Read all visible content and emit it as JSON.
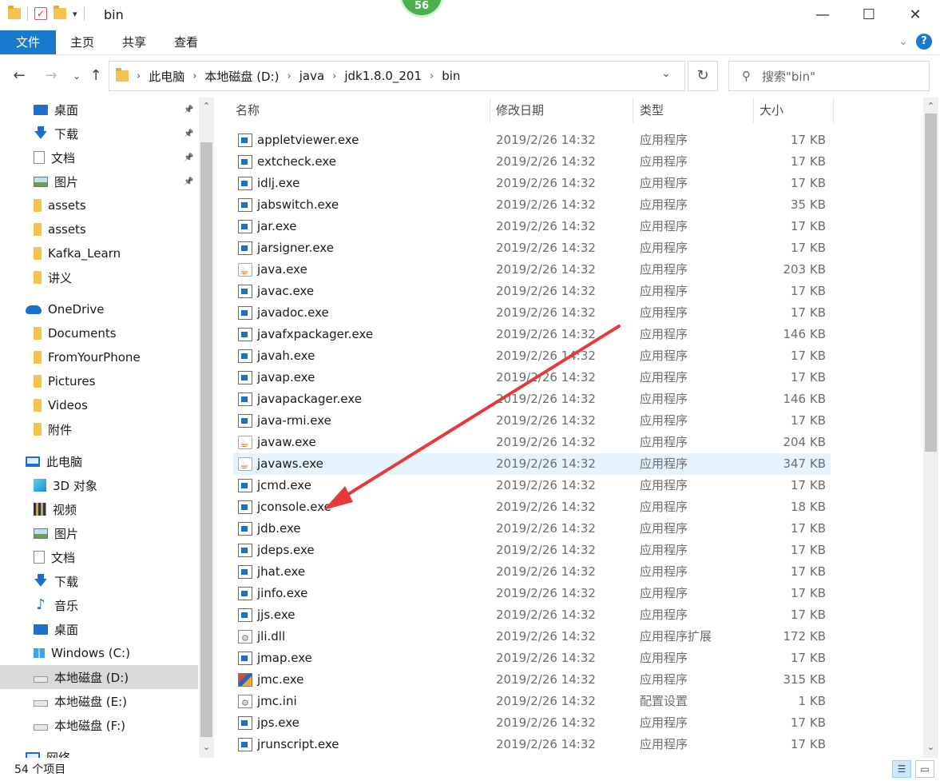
{
  "window": {
    "title": "bin",
    "badge": "56",
    "controls": {
      "minimize": "—",
      "maximize": "☐",
      "close": "✕"
    }
  },
  "ribbon": {
    "tabs": [
      "文件",
      "主页",
      "共享",
      "查看"
    ],
    "expand_icon": "chevron-down-icon",
    "help": "?"
  },
  "address": {
    "crumbs": [
      "此电脑",
      "本地磁盘 (D:)",
      "java",
      "jdk1.8.0_201",
      "bin"
    ],
    "search_placeholder": "搜索\"bin\""
  },
  "sidebar": {
    "items": [
      {
        "label": "桌面",
        "icon": "desktop-icon",
        "pinned": true
      },
      {
        "label": "下载",
        "icon": "download-icon",
        "pinned": true
      },
      {
        "label": "文档",
        "icon": "document-icon",
        "pinned": true
      },
      {
        "label": "图片",
        "icon": "picture-icon",
        "pinned": true
      },
      {
        "label": "assets",
        "icon": "folder-icon"
      },
      {
        "label": "assets",
        "icon": "folder-icon"
      },
      {
        "label": "Kafka_Learn",
        "icon": "folder-icon"
      },
      {
        "label": "讲义",
        "icon": "folder-icon"
      },
      {
        "label": "OneDrive",
        "icon": "onedrive-icon"
      },
      {
        "label": "Documents",
        "icon": "folder-icon"
      },
      {
        "label": "FromYourPhone",
        "icon": "folder-icon"
      },
      {
        "label": "Pictures",
        "icon": "folder-icon"
      },
      {
        "label": "Videos",
        "icon": "folder-icon"
      },
      {
        "label": "附件",
        "icon": "folder-icon"
      },
      {
        "label": "此电脑",
        "icon": "this-pc-icon"
      },
      {
        "label": "3D 对象",
        "icon": "3d-objects-icon"
      },
      {
        "label": "视频",
        "icon": "video-icon"
      },
      {
        "label": "图片",
        "icon": "picture-icon"
      },
      {
        "label": "文档",
        "icon": "document-icon"
      },
      {
        "label": "下载",
        "icon": "download-icon"
      },
      {
        "label": "音乐",
        "icon": "music-icon"
      },
      {
        "label": "桌面",
        "icon": "desktop-icon"
      },
      {
        "label": "Windows (C:)",
        "icon": "windows-drive-icon"
      },
      {
        "label": "本地磁盘 (D:)",
        "icon": "drive-icon",
        "selected": true
      },
      {
        "label": "本地磁盘 (E:)",
        "icon": "drive-icon"
      },
      {
        "label": "本地磁盘 (F:)",
        "icon": "drive-icon"
      },
      {
        "label": "网络",
        "icon": "network-icon"
      }
    ]
  },
  "columns": [
    "名称",
    "修改日期",
    "类型",
    "大小"
  ],
  "files": [
    {
      "name": "appletviewer.exe",
      "date": "2019/2/26 14:32",
      "type": "应用程序",
      "size": "17 KB",
      "icon": "exe-icon"
    },
    {
      "name": "extcheck.exe",
      "date": "2019/2/26 14:32",
      "type": "应用程序",
      "size": "17 KB",
      "icon": "exe-icon"
    },
    {
      "name": "idlj.exe",
      "date": "2019/2/26 14:32",
      "type": "应用程序",
      "size": "17 KB",
      "icon": "exe-icon"
    },
    {
      "name": "jabswitch.exe",
      "date": "2019/2/26 14:32",
      "type": "应用程序",
      "size": "35 KB",
      "icon": "exe-icon"
    },
    {
      "name": "jar.exe",
      "date": "2019/2/26 14:32",
      "type": "应用程序",
      "size": "17 KB",
      "icon": "exe-icon"
    },
    {
      "name": "jarsigner.exe",
      "date": "2019/2/26 14:32",
      "type": "应用程序",
      "size": "17 KB",
      "icon": "exe-icon"
    },
    {
      "name": "java.exe",
      "date": "2019/2/26 14:32",
      "type": "应用程序",
      "size": "203 KB",
      "icon": "java-icon"
    },
    {
      "name": "javac.exe",
      "date": "2019/2/26 14:32",
      "type": "应用程序",
      "size": "17 KB",
      "icon": "exe-icon"
    },
    {
      "name": "javadoc.exe",
      "date": "2019/2/26 14:32",
      "type": "应用程序",
      "size": "17 KB",
      "icon": "exe-icon"
    },
    {
      "name": "javafxpackager.exe",
      "date": "2019/2/26 14:32",
      "type": "应用程序",
      "size": "146 KB",
      "icon": "exe-icon"
    },
    {
      "name": "javah.exe",
      "date": "2019/2/26 14:32",
      "type": "应用程序",
      "size": "17 KB",
      "icon": "exe-icon"
    },
    {
      "name": "javap.exe",
      "date": "2019/2/26 14:32",
      "type": "应用程序",
      "size": "17 KB",
      "icon": "exe-icon"
    },
    {
      "name": "javapackager.exe",
      "date": "2019/2/26 14:32",
      "type": "应用程序",
      "size": "146 KB",
      "icon": "exe-icon"
    },
    {
      "name": "java-rmi.exe",
      "date": "2019/2/26 14:32",
      "type": "应用程序",
      "size": "17 KB",
      "icon": "exe-icon"
    },
    {
      "name": "javaw.exe",
      "date": "2019/2/26 14:32",
      "type": "应用程序",
      "size": "204 KB",
      "icon": "java-icon"
    },
    {
      "name": "javaws.exe",
      "date": "2019/2/26 14:32",
      "type": "应用程序",
      "size": "347 KB",
      "icon": "java-icon",
      "highlighted": true
    },
    {
      "name": "jcmd.exe",
      "date": "2019/2/26 14:32",
      "type": "应用程序",
      "size": "17 KB",
      "icon": "exe-icon"
    },
    {
      "name": "jconsole.exe",
      "date": "2019/2/26 14:32",
      "type": "应用程序",
      "size": "18 KB",
      "icon": "exe-icon"
    },
    {
      "name": "jdb.exe",
      "date": "2019/2/26 14:32",
      "type": "应用程序",
      "size": "17 KB",
      "icon": "exe-icon"
    },
    {
      "name": "jdeps.exe",
      "date": "2019/2/26 14:32",
      "type": "应用程序",
      "size": "17 KB",
      "icon": "exe-icon"
    },
    {
      "name": "jhat.exe",
      "date": "2019/2/26 14:32",
      "type": "应用程序",
      "size": "17 KB",
      "icon": "exe-icon"
    },
    {
      "name": "jinfo.exe",
      "date": "2019/2/26 14:32",
      "type": "应用程序",
      "size": "17 KB",
      "icon": "exe-icon"
    },
    {
      "name": "jjs.exe",
      "date": "2019/2/26 14:32",
      "type": "应用程序",
      "size": "17 KB",
      "icon": "exe-icon"
    },
    {
      "name": "jli.dll",
      "date": "2019/2/26 14:32",
      "type": "应用程序扩展",
      "size": "172 KB",
      "icon": "dll-icon"
    },
    {
      "name": "jmap.exe",
      "date": "2019/2/26 14:32",
      "type": "应用程序",
      "size": "17 KB",
      "icon": "exe-icon"
    },
    {
      "name": "jmc.exe",
      "date": "2019/2/26 14:32",
      "type": "应用程序",
      "size": "315 KB",
      "icon": "jmc-icon"
    },
    {
      "name": "jmc.ini",
      "date": "2019/2/26 14:32",
      "type": "配置设置",
      "size": "1 KB",
      "icon": "ini-icon"
    },
    {
      "name": "jps.exe",
      "date": "2019/2/26 14:32",
      "type": "应用程序",
      "size": "17 KB",
      "icon": "exe-icon"
    },
    {
      "name": "jrunscript.exe",
      "date": "2019/2/26 14:32",
      "type": "应用程序",
      "size": "17 KB",
      "icon": "exe-icon"
    }
  ],
  "status": {
    "count": "54 个项目"
  },
  "annotation": {
    "color": "#e8393a",
    "target": "jconsole.exe"
  }
}
